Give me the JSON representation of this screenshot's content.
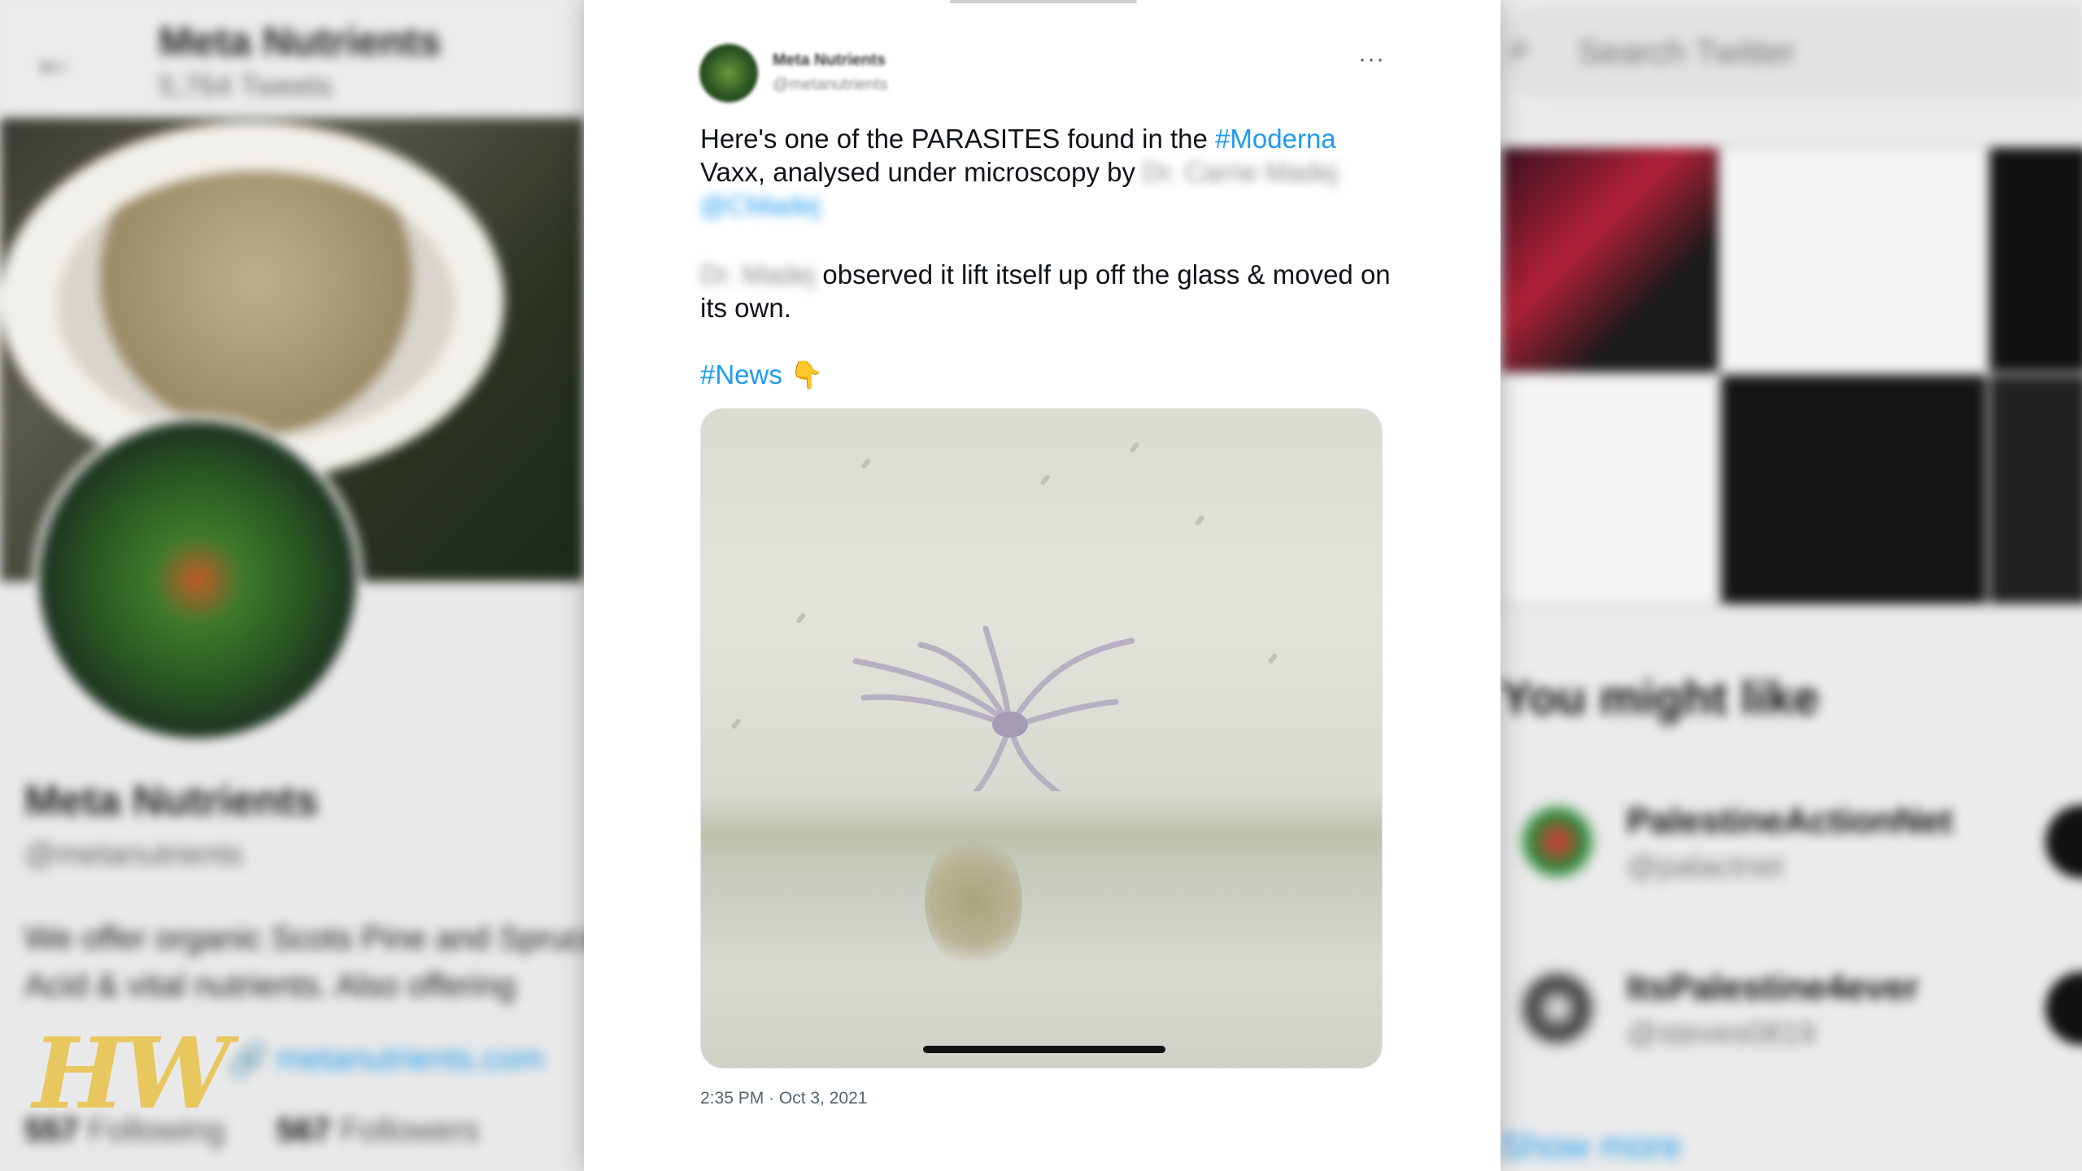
{
  "left_profile": {
    "back_icon": "arrow-left-icon",
    "name": "Meta Nutrients",
    "tweet_count": "5,764 Tweets",
    "display_name": "Meta Nutrients",
    "handle": "@metanutrients",
    "bio": "We offer organic Scots Pine and Spruce Acid & vital nutrients. Also offering",
    "link": "metanutrients.com",
    "following_count": "557",
    "following_label": "Following",
    "followers_count": "567",
    "followers_label": "Followers"
  },
  "watermark": "HW",
  "tweet": {
    "author_name": "Meta Nutrients",
    "author_handle": "@metanutrients",
    "more_icon": "···",
    "p1_text_a": "Here's one of the PARASITES found in the ",
    "p1_hashtag": "#Moderna",
    "p1_text_b": " Vaxx, analysed under microscopy by ",
    "p1_redacted_name": "Dr. Carrie Madej",
    "p1_redacted_handle": "@CMadej",
    "p2_redacted_name": "Dr. Madej",
    "p2_text": " observed it lift itself up off the glass & moved on its own.",
    "p3_hashtag": "#News",
    "p3_emoji": "👇",
    "media_progress": 0.0,
    "timestamp": "2:35 PM · Oct 3, 2021"
  },
  "right_panel": {
    "search_placeholder": "Search Twitter",
    "you_might_like": "You might like",
    "suggestions": [
      {
        "name": "PalestineActionNet",
        "handle": "@palactnet"
      },
      {
        "name": "ItsPalestine4ever",
        "handle": "@steves0819"
      }
    ],
    "show_more": "Show more"
  },
  "colors": {
    "link_blue": "#1d9bf0",
    "text_primary": "#0f1419",
    "text_secondary": "#536471"
  }
}
